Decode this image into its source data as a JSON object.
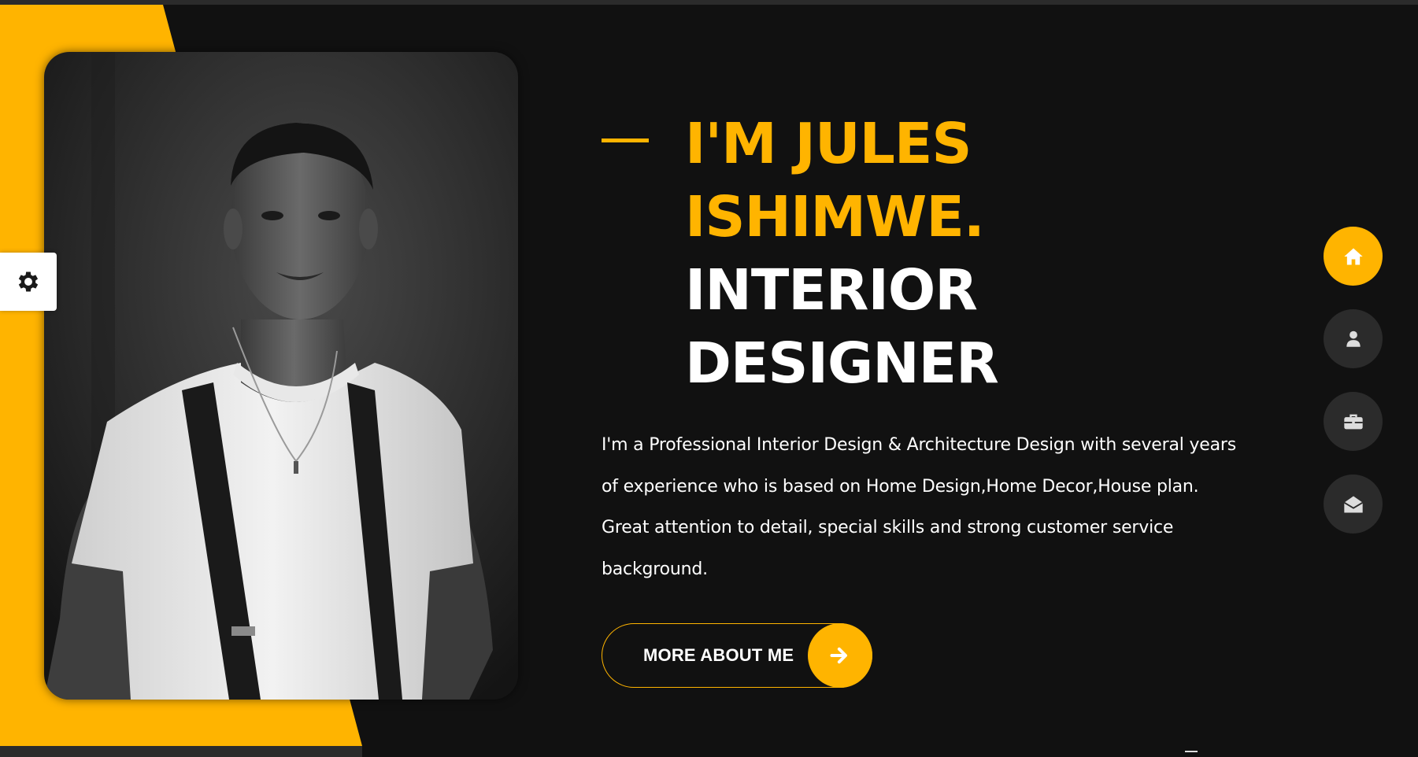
{
  "colors": {
    "accent": "#ffb400",
    "background": "#111111",
    "text": "#ffffff",
    "nav_inactive": "#2b2b2b"
  },
  "settings": {
    "icon": "gear-icon"
  },
  "hero": {
    "title_line_1": "I'M JULES",
    "title_line_2": "ISHIMWE.",
    "title_line_3": "INTERIOR",
    "title_line_4": "DESIGNER",
    "bio": "I'm a Professional Interior Design & Architecture Design with several years of experience who is based on Home Design,Home Decor,House plan. Great attention to detail, special skills and strong customer service background.",
    "cta_label": "MORE ABOUT ME",
    "cta_icon": "arrow-right-icon"
  },
  "side_nav": {
    "items": [
      {
        "icon": "home-icon",
        "active": true
      },
      {
        "icon": "user-icon",
        "active": false
      },
      {
        "icon": "briefcase-icon",
        "active": false
      },
      {
        "icon": "envelope-open-icon",
        "active": false
      }
    ]
  }
}
